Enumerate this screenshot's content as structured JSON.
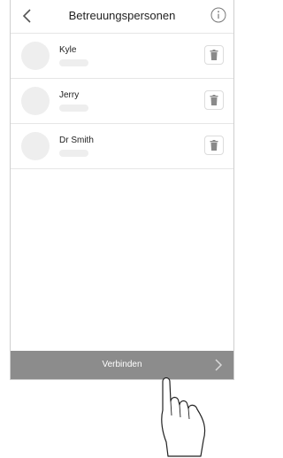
{
  "header": {
    "title": "Betreuungspersonen",
    "back_icon": "chevron-left-icon",
    "info_icon": "info-icon"
  },
  "contacts": [
    {
      "name": "Kyle"
    },
    {
      "name": "Jerry"
    },
    {
      "name": "Dr Smith"
    }
  ],
  "delete_icon": "trash-icon",
  "footer": {
    "button_label": "Verbinden",
    "chevron_icon": "chevron-right-icon"
  },
  "overlay": {
    "pointer_icon": "hand-pointer-icon"
  },
  "colors": {
    "footer_bg": "#8c8c8c",
    "placeholder": "#eeeeee",
    "text": "#222222"
  }
}
